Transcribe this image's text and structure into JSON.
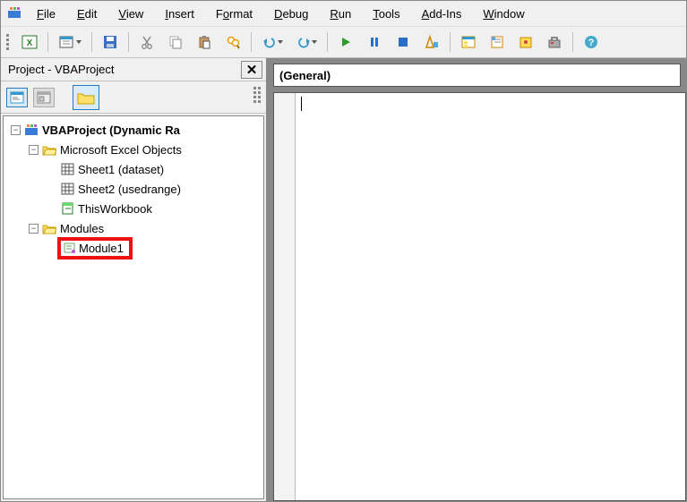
{
  "menu": {
    "items": [
      {
        "label": "File",
        "u": 0
      },
      {
        "label": "Edit",
        "u": 0
      },
      {
        "label": "View",
        "u": 0
      },
      {
        "label": "Insert",
        "u": 0
      },
      {
        "label": "Format",
        "u": 1
      },
      {
        "label": "Debug",
        "u": 0
      },
      {
        "label": "Run",
        "u": 0
      },
      {
        "label": "Tools",
        "u": 0
      },
      {
        "label": "Add-Ins",
        "u": 0
      },
      {
        "label": "Window",
        "u": 0
      }
    ]
  },
  "project_panel": {
    "title": "Project - VBAProject",
    "root": "VBAProject (Dynamic Ra",
    "excel_objects": "Microsoft Excel Objects",
    "sheet1": "Sheet1 (dataset)",
    "sheet2": "Sheet2 (usedrange)",
    "this_workbook": "ThisWorkbook",
    "modules": "Modules",
    "module1": "Module1"
  },
  "code": {
    "scope_dropdown": "(General)"
  },
  "icons": {
    "excel": "excel-icon",
    "view": "view-icon",
    "save": "save-icon",
    "cut": "cut-icon",
    "copy": "copy-icon",
    "paste": "paste-icon",
    "find": "find-icon",
    "undo": "undo-icon",
    "redo": "redo-icon",
    "run": "run-icon",
    "break": "break-icon",
    "stop": "stop-icon",
    "design": "design-icon",
    "explorer": "explorer-icon",
    "properties": "properties-icon",
    "object": "object-icon",
    "toolbox": "toolbox-icon",
    "help": "help-icon"
  }
}
